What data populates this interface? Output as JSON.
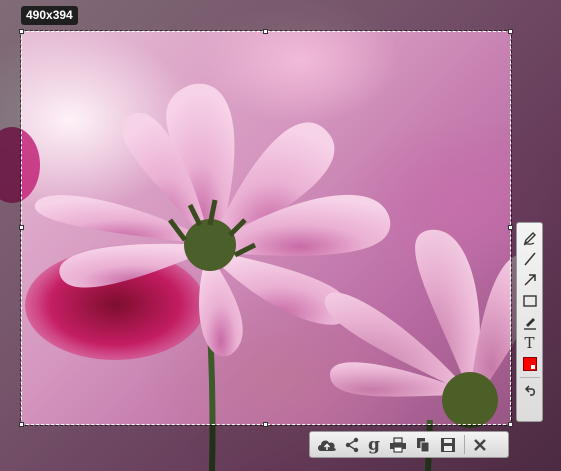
{
  "capture": {
    "size_label": "490x394"
  },
  "tools": {
    "items": [
      {
        "name": "pen-tool",
        "icon": "pen-icon"
      },
      {
        "name": "line-tool",
        "icon": "line-icon"
      },
      {
        "name": "arrow-tool",
        "icon": "arrow-icon"
      },
      {
        "name": "rectangle-tool",
        "icon": "rectangle-icon"
      },
      {
        "name": "marker-tool",
        "icon": "marker-icon"
      },
      {
        "name": "text-tool",
        "icon": "text-icon",
        "glyph": "T"
      },
      {
        "name": "color-picker",
        "icon": "color-swatch",
        "color": "#ff0000"
      },
      {
        "name": "undo-button",
        "icon": "undo-icon"
      }
    ]
  },
  "actions": {
    "items": [
      {
        "name": "upload-button",
        "icon": "cloud-upload-icon"
      },
      {
        "name": "share-button",
        "icon": "share-icon"
      },
      {
        "name": "google-search-button",
        "icon": "google-icon",
        "glyph": "g"
      },
      {
        "name": "print-button",
        "icon": "print-icon"
      },
      {
        "name": "copy-button",
        "icon": "copy-icon"
      },
      {
        "name": "save-button",
        "icon": "save-icon"
      },
      {
        "name": "close-button",
        "icon": "close-icon"
      }
    ]
  },
  "colors": {
    "badge_bg": "#1f1f1f",
    "active_color": "#ff0000",
    "toolbar_bg": "#e8e8e8"
  }
}
